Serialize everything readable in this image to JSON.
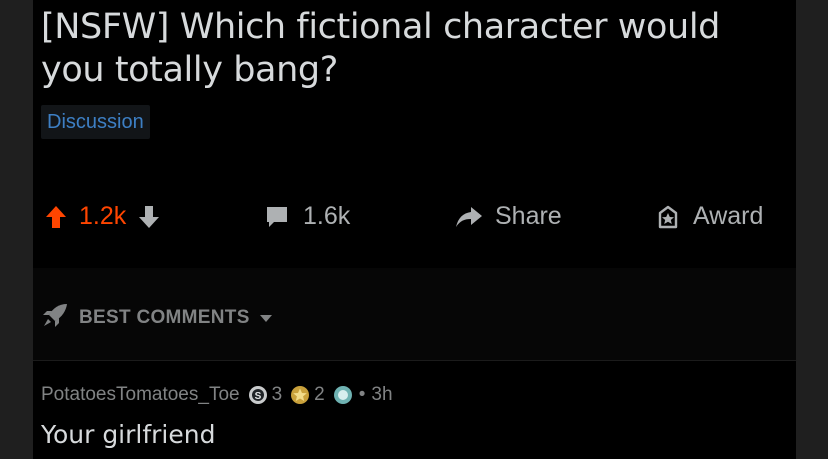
{
  "post": {
    "title": "[NSFW] Which fictional character would you totally bang?",
    "flair": "Discussion"
  },
  "actions": {
    "upvotes": "1.2k",
    "comments": "1.6k",
    "share_label": "Share",
    "award_label": "Award"
  },
  "sort": {
    "label": "BEST COMMENTS"
  },
  "comment": {
    "username": "PotatoesTomatoes_Toe",
    "award_silver_count": "3",
    "award_gold_count": "2",
    "separator": "•",
    "age": "3h",
    "text": "Your girlfriend"
  },
  "colors": {
    "upvote": "#ff4500",
    "flair_text": "#3d7fc4",
    "muted": "#818384",
    "text": "#d7dadc"
  }
}
